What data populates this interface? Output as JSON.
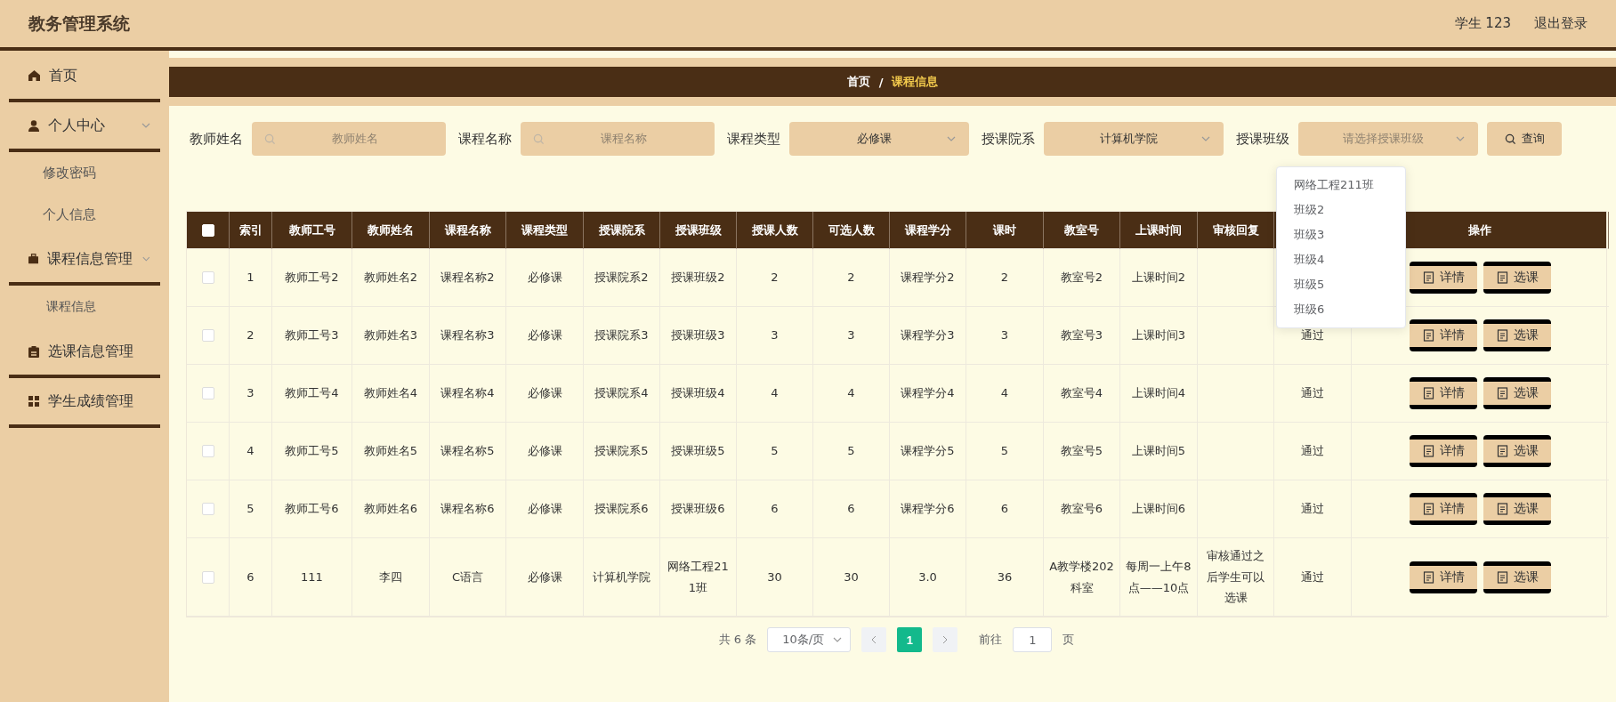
{
  "header": {
    "title": "教务管理系统",
    "user": "学生 123",
    "logout": "退出登录"
  },
  "sidebar": {
    "items": [
      {
        "label": "首页"
      },
      {
        "label": "个人中心",
        "children": [
          {
            "label": "修改密码"
          },
          {
            "label": "个人信息"
          }
        ]
      },
      {
        "label": "课程信息管理",
        "children": [
          {
            "label": "课程信息"
          }
        ]
      },
      {
        "label": "选课信息管理"
      },
      {
        "label": "学生成绩管理"
      }
    ]
  },
  "breadcrumb": {
    "items": [
      {
        "label": "首页",
        "selected": false
      },
      {
        "label": "课程信息",
        "selected": true
      }
    ],
    "separator": "/"
  },
  "filters": [
    {
      "label": "教师姓名",
      "kind": "text",
      "placeholder": "教师姓名"
    },
    {
      "label": "课程名称",
      "kind": "text",
      "placeholder": "课程名称"
    },
    {
      "label": "课程类型",
      "kind": "select",
      "value": "必修课"
    },
    {
      "label": "授课院系",
      "kind": "select",
      "value": "计算机学院"
    },
    {
      "label": "授课班级",
      "kind": "select",
      "placeholder": "请选择授课班级"
    }
  ],
  "search_button": "查询",
  "dropdown": {
    "options": [
      "网络工程211班",
      "班级2",
      "班级3",
      "班级4",
      "班级5",
      "班级6"
    ]
  },
  "table": {
    "select_all_checked": false,
    "columns": [
      "索引",
      "教师工号",
      "教师姓名",
      "课程名称",
      "课程类型",
      "授课院系",
      "授课班级",
      "授课人数",
      "可选人数",
      "课程学分",
      "课时",
      "教室号",
      "上课时间",
      "审核回复",
      null,
      "操作"
    ],
    "rows": [
      {
        "checked": false,
        "cells": [
          "1",
          "教师工号2",
          "教师姓名2",
          "课程名称2",
          "必修课",
          "授课院系2",
          "授课班级2",
          "2",
          "2",
          "课程学分2",
          "2",
          "教室号2",
          "上课时间2",
          null,
          null
        ],
        "actions": [
          "详情",
          "选课"
        ]
      },
      {
        "checked": false,
        "cells": [
          "2",
          "教师工号3",
          "教师姓名3",
          "课程名称3",
          "必修课",
          "授课院系3",
          "授课班级3",
          "3",
          "3",
          "课程学分3",
          "3",
          "教室号3",
          "上课时间3",
          null,
          "通过"
        ],
        "actions": [
          "详情",
          "选课"
        ]
      },
      {
        "checked": false,
        "cells": [
          "3",
          "教师工号4",
          "教师姓名4",
          "课程名称4",
          "必修课",
          "授课院系4",
          "授课班级4",
          "4",
          "4",
          "课程学分4",
          "4",
          "教室号4",
          "上课时间4",
          null,
          "通过"
        ],
        "actions": [
          "详情",
          "选课"
        ]
      },
      {
        "checked": false,
        "cells": [
          "4",
          "教师工号5",
          "教师姓名5",
          "课程名称5",
          "必修课",
          "授课院系5",
          "授课班级5",
          "5",
          "5",
          "课程学分5",
          "5",
          "教室号5",
          "上课时间5",
          null,
          "通过"
        ],
        "actions": [
          "详情",
          "选课"
        ]
      },
      {
        "checked": false,
        "cells": [
          "5",
          "教师工号6",
          "教师姓名6",
          "课程名称6",
          "必修课",
          "授课院系6",
          "授课班级6",
          "6",
          "6",
          "课程学分6",
          "6",
          "教室号6",
          "上课时间6",
          null,
          "通过"
        ],
        "actions": [
          "详情",
          "选课"
        ]
      },
      {
        "checked": false,
        "cells": [
          "6",
          "111",
          "李四",
          "C语言",
          "必修课",
          "计算机学院",
          "网络工程211班",
          "30",
          "30",
          "3.0",
          "36",
          "A教学楼202科室",
          "每周一上午8点——10点",
          "审核通过之后学生可以选课",
          "通过"
        ],
        "actions": [
          "详情",
          "选课"
        ]
      }
    ]
  },
  "pagination": {
    "total": "共 6 条",
    "page_size": "10条/页",
    "pages": [
      {
        "label": "1",
        "selected": true
      }
    ],
    "goto_label": "前往",
    "goto_value": "1",
    "goto_suffix": "页"
  }
}
